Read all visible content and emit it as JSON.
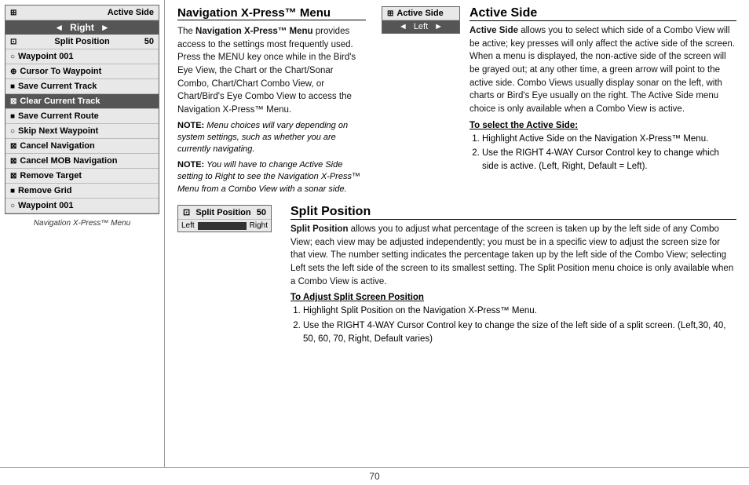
{
  "header": {
    "title": "Navigation X-Press™ Menu"
  },
  "menu": {
    "caption": "Navigation X-Press™ Menu",
    "items": [
      {
        "label": "Active Side",
        "icon": "⊕",
        "type": "active-side"
      },
      {
        "label": "Right",
        "type": "active-side-value"
      },
      {
        "label": "Split Position",
        "icon": "⊡",
        "value": "50",
        "type": "split-pos"
      },
      {
        "label": "Waypoint 001",
        "icon": "○"
      },
      {
        "label": "Cursor To Waypoint",
        "icon": "⊕"
      },
      {
        "label": "Save Current Track",
        "icon": "■"
      },
      {
        "label": "Clear Current Track",
        "icon": "⊠",
        "highlighted": true
      },
      {
        "label": "Save Current Route",
        "icon": "■"
      },
      {
        "label": "Skip Next Waypoint",
        "icon": "○"
      },
      {
        "label": "Cancel Navigation",
        "icon": "⊠"
      },
      {
        "label": "Cancel MOB Navigation",
        "icon": "⊠"
      },
      {
        "label": "Remove Target",
        "icon": "⊠"
      },
      {
        "label": "Remove Grid",
        "icon": "■"
      },
      {
        "label": "Waypoint 001",
        "icon": "○"
      }
    ]
  },
  "active_side_section": {
    "title": "Active Side",
    "widget": {
      "label": "Active Side",
      "icon": "⊞",
      "value": "Left"
    },
    "body": "Active Side allows you to select which side of a Combo View will be active; key presses will only affect the active side of the screen. When a menu is displayed, the non-active side of the screen will be grayed out; at any other time, a green arrow will point to the active side. Combo Views usually display sonar on the left, with charts or Bird's Eye usually on the right. The Active Side menu choice is only available when a Combo View is active.",
    "subheading": "To select the Active Side:",
    "steps": [
      "Highlight Active Side on the Navigation X-Press™ Menu.",
      "Use the RIGHT 4-WAY Cursor Control key to change which side is active. (Left, Right, Default = Left)."
    ]
  },
  "split_position_section": {
    "title": "Split Position",
    "widget": {
      "label": "Split Position",
      "value": "50",
      "left_label": "Left",
      "right_label": "Right"
    },
    "body": "Split Position allows you to adjust what percentage of the screen is taken up by the left side of any Combo View; each view may be adjusted independently; you must be in a specific view to adjust the screen size for that view. The number setting indicates the percentage taken up by the left side of the Combo View; selecting Left sets the left side of the screen to its smallest setting. The Split Position menu choice is only available when a Combo View is active.",
    "subheading": "To Adjust Split Screen Position",
    "steps": [
      "Highlight Split Position on the Navigation X-Press™ Menu.",
      "Use the RIGHT 4-WAY Cursor Control key to change the size of the left side of a split screen. (Left,30, 40, 50, 60, 70, Right, Default varies)"
    ]
  },
  "left_content": {
    "title": "Navigation X-Press™ Menu",
    "intro": "The Navigation X-Press™ Menu provides access to the settings most frequently used. Press the MENU key once while in the Bird's Eye View, the Chart or the Chart/Sonar Combo, Chart/Chart Combo View, or Chart/Bird's Eye Combo View to access the Navigation X-Press™ Menu.",
    "note1_label": "NOTE:",
    "note1": "Menu choices will vary depending on system settings, such as whether you are currently navigating.",
    "note2_label": "NOTE:",
    "note2": "You will have to change Active Side setting to Right to see the Navigation X-Press™ Menu from a Combo View with a sonar side."
  },
  "footer": {
    "page_number": "70"
  }
}
